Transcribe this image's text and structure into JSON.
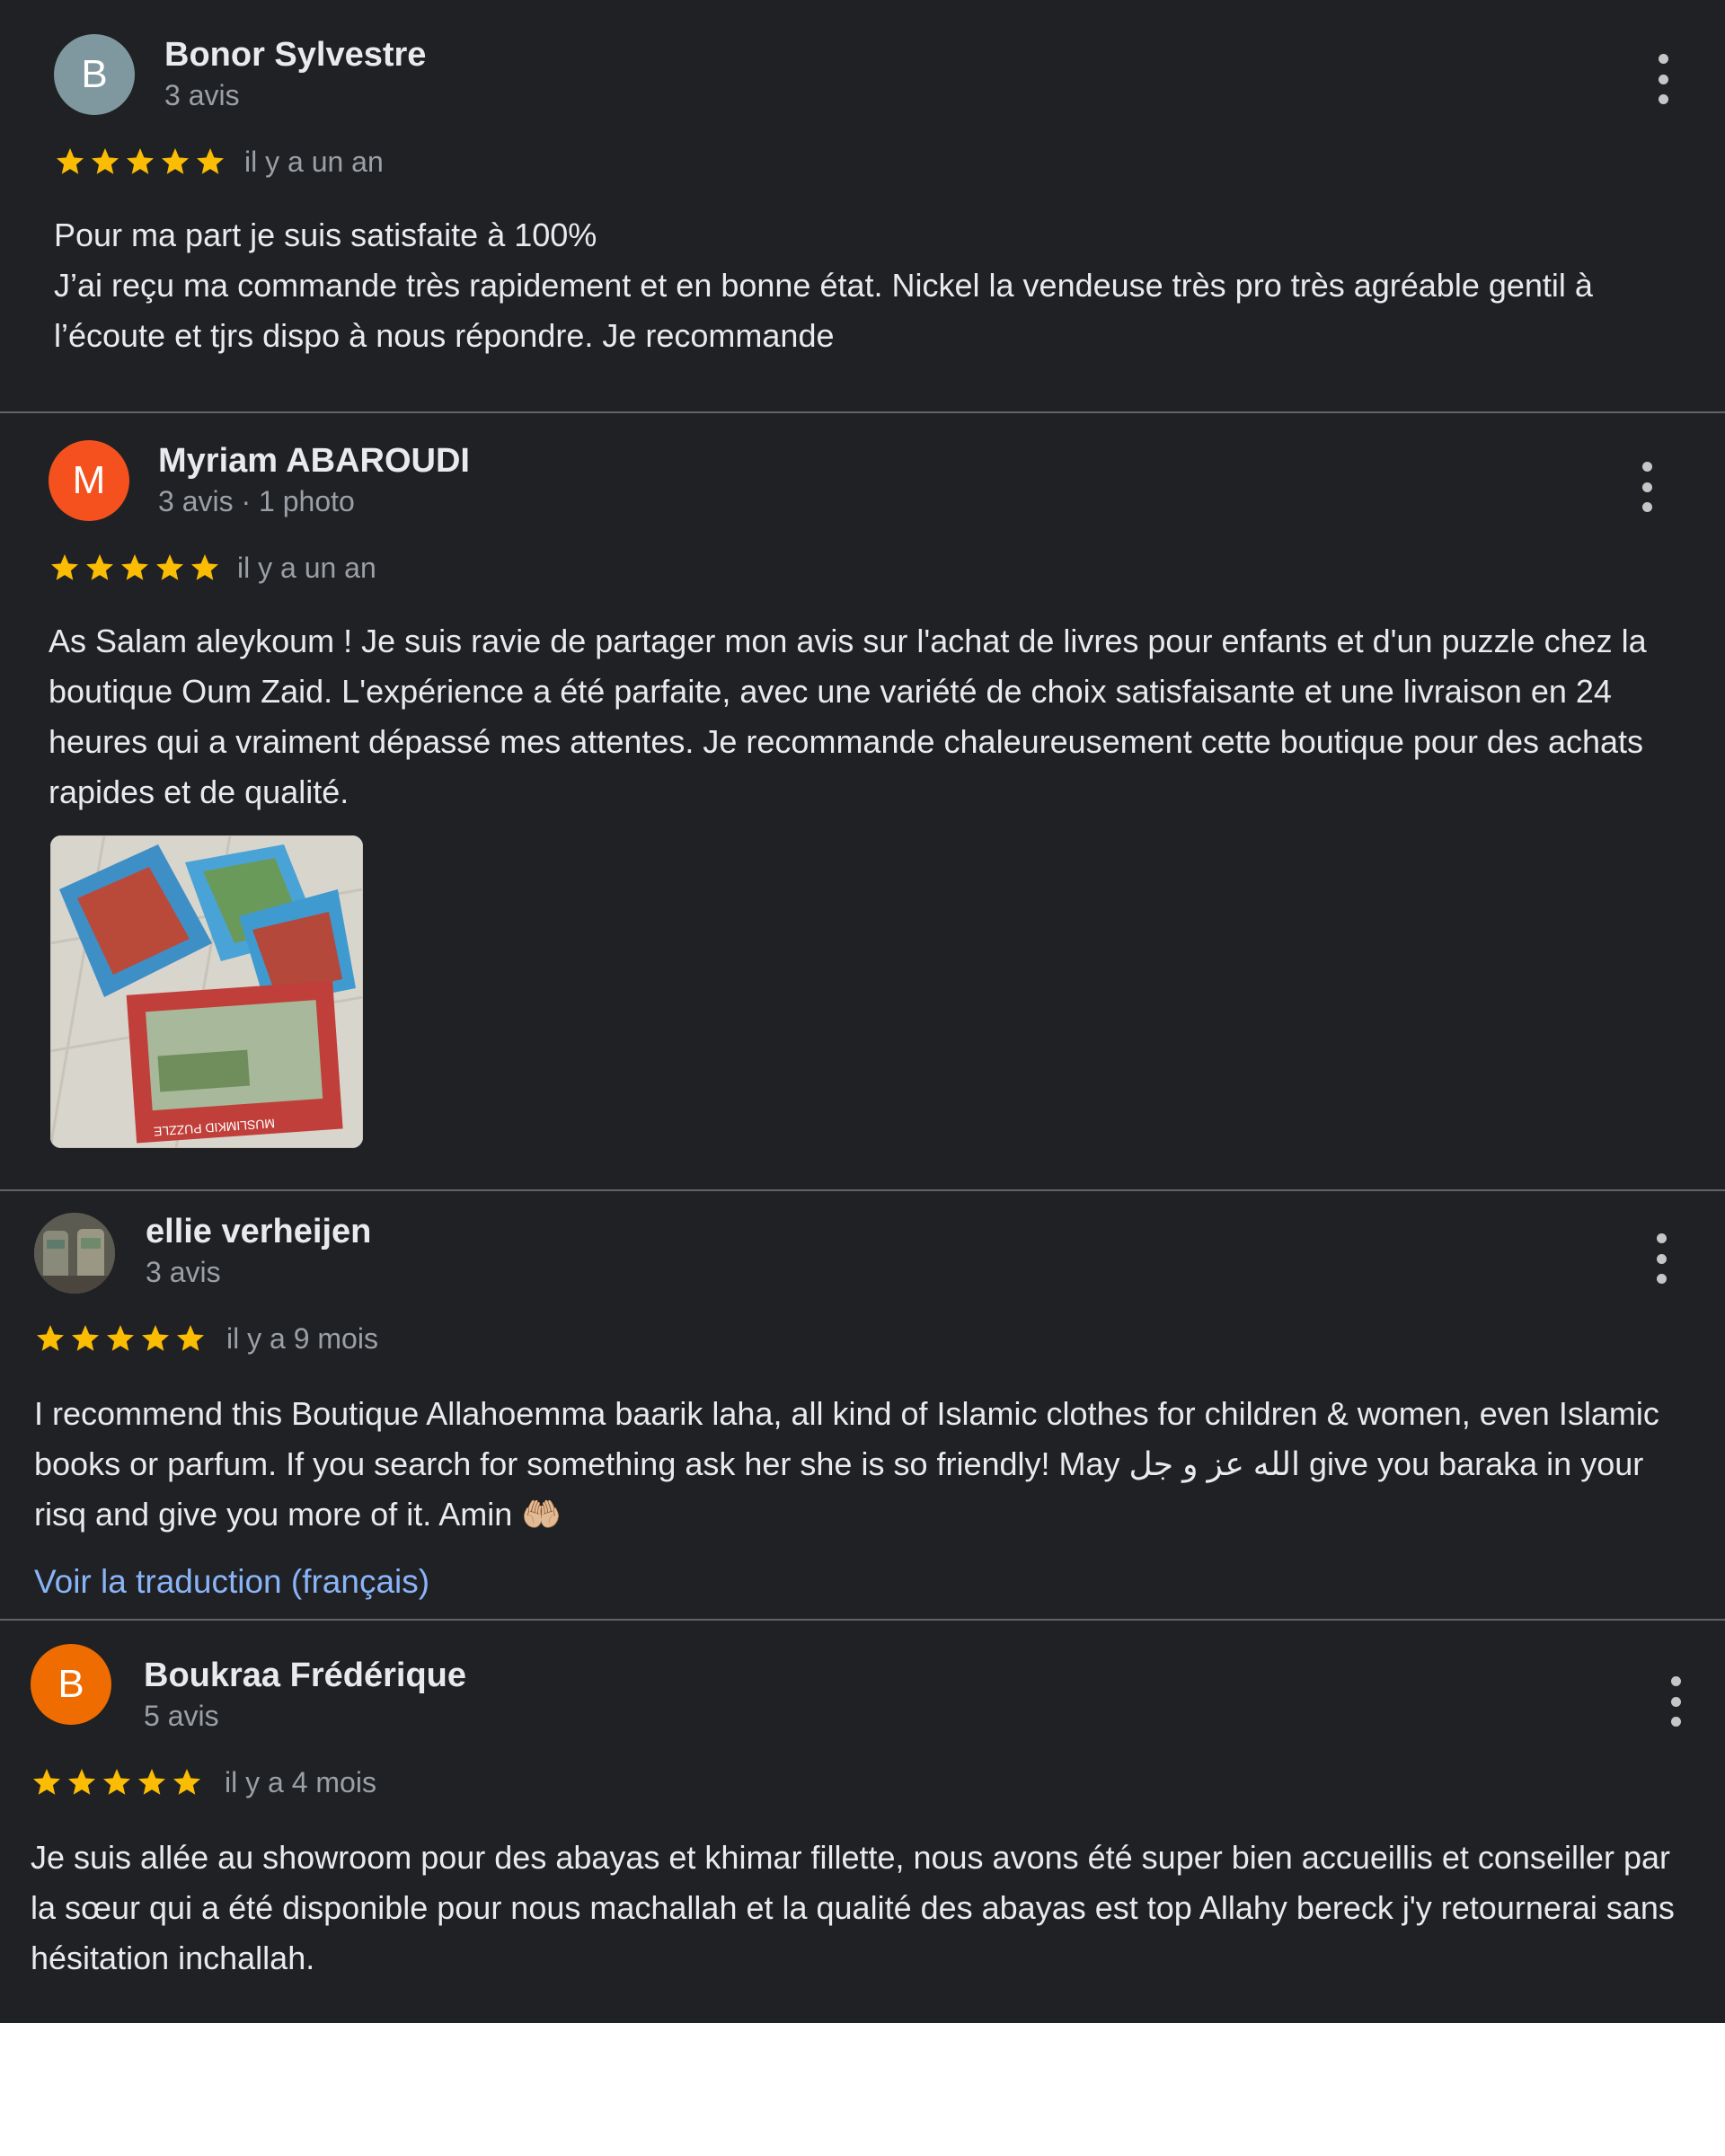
{
  "colors": {
    "background": "#202124",
    "divider": "#5f6368",
    "text_primary": "#e8eaed",
    "text_secondary": "#9aa0a6",
    "star": "#fbbc04",
    "link": "#8ab4f8"
  },
  "reviews": [
    {
      "avatar_letter": "B",
      "avatar_color": "#7f98a0",
      "name": "Bonor Sylvestre",
      "meta": "3 avis",
      "rating": 5,
      "date": "il y a un an",
      "text": "Pour ma part je suis satisfaite à 100%\nJ’ai reçu ma commande très rapidement et en bonne état. Nickel la vendeuse très pro très agréable gentil à l’écoute et tjrs dispo à nous répondre. Je recommande"
    },
    {
      "avatar_letter": "M",
      "avatar_color": "#f4511e",
      "name": "Myriam ABAROUDI",
      "meta": "3 avis · 1 photo",
      "rating": 5,
      "date": "il y a un an",
      "text": "As Salam aleykoum ! Je suis ravie de partager mon avis sur l'achat de livres pour enfants et d'un puzzle chez la boutique Oum Zaid. L'expérience a été parfaite, avec une variété de choix satisfaisante et une livraison en 24 heures qui a vraiment dépassé mes attentes. Je recommande chaleureusement cette boutique pour des achats rapides et de qualité.",
      "photo_caption": "MUSLIMKID PUZZLE"
    },
    {
      "avatar_letter": "",
      "name": "ellie verheijen",
      "meta": "3 avis",
      "rating": 5,
      "date": "il y a 9 mois",
      "text": "I recommend this Boutique Allahoemma baarik laha, all kind of Islamic clothes for children & women, even Islamic books or parfum. If you search for something ask her she is so friendly! May الله عز و جل give you baraka in your risq and give you more of it. Amin 🤲🏼",
      "translate_label": "Voir la traduction (français)"
    },
    {
      "avatar_letter": "B",
      "avatar_color": "#ef6c00",
      "name": "Boukraa Frédérique",
      "meta": "5 avis",
      "rating": 5,
      "date": "il y a 4 mois",
      "text": "Je suis allée au showroom pour des abayas et khimar fillette, nous avons été super bien accueillis et conseiller par la sœur qui a été disponible pour nous machallah et la qualité des abayas est top Allahy bereck j'y retournerai sans hésitation inchallah."
    }
  ]
}
